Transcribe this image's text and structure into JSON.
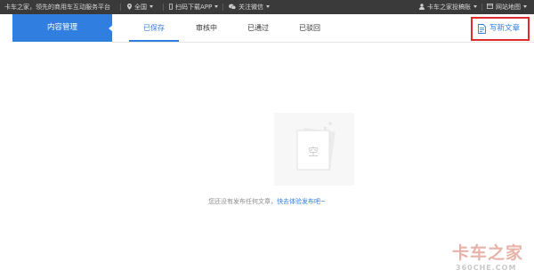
{
  "topbar": {
    "slogan": "卡车之家，领先的商用车互动服务平台",
    "location": "全国",
    "app_download": "扫码下载APP",
    "wechat": "关注微信",
    "account": "卡车之家投稿账",
    "sitemap": "网站地图"
  },
  "sidebar": {
    "content_management": "内容管理"
  },
  "tabs": [
    {
      "label": "已保存",
      "active": true
    },
    {
      "label": "审核中",
      "active": false
    },
    {
      "label": "已通过",
      "active": false
    },
    {
      "label": "已驳回",
      "active": false
    }
  ],
  "write_button": {
    "label": "写新文章"
  },
  "empty_state": {
    "illustration_char": "空",
    "message": "您还没有发布任何文章，",
    "link": "快去体验发布吧~"
  },
  "watermark": {
    "brand": "卡车之家",
    "domain": "360CHE.COM"
  },
  "colors": {
    "accent": "#2f7ee0",
    "highlight_border": "#e02b2b",
    "topbar_bg": "#3a3a3a"
  }
}
